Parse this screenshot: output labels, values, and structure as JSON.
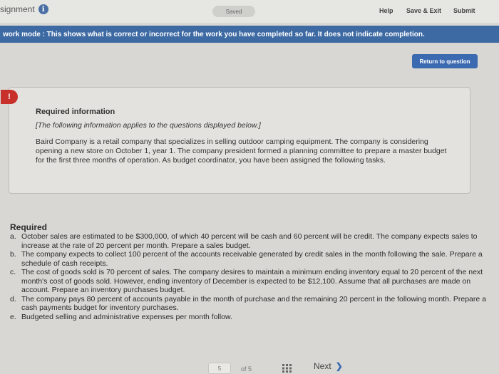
{
  "topbar": {
    "assignment_label": "signment",
    "saved_label": "Saved",
    "help_label": "Help",
    "save_exit_label": "Save & Exit",
    "submit_label": "Submit"
  },
  "mode_banner": "work mode : This shows what is correct or incorrect for the work you have completed so far. It does not indicate completion.",
  "return_button": "Return to question",
  "alert_badge": "!",
  "required_information": {
    "title": "Required information",
    "subtitle": "[The following information applies to the questions displayed below.]",
    "body": "Baird Company is a retail company that specializes in selling outdoor camping equipment. The company is considering opening a new store on October 1, year 1. The company president formed a planning committee to prepare a master budget for the first three months of operation. As budget coordinator, you have been assigned the following tasks."
  },
  "required": {
    "title": "Required",
    "items": [
      {
        "letter": "a.",
        "text": "October sales are estimated to be $300,000, of which 40 percent will be cash and 60 percent will be credit. The company expects sales to increase at the rate of 20 percent per month. Prepare a sales budget."
      },
      {
        "letter": "b.",
        "text": "The company expects to collect 100 percent of the accounts receivable generated by credit sales in the month following the sale. Prepare a schedule of cash receipts."
      },
      {
        "letter": "c.",
        "text": "The cost of goods sold is 70 percent of sales. The company desires to maintain a minimum ending inventory equal to 20 percent of the next month's cost of goods sold. However, ending inventory of December is expected to be $12,100. Assume that all purchases are made on account. Prepare an inventory purchases budget."
      },
      {
        "letter": "d.",
        "text": "The company pays 80 percent of accounts payable in the month of purchase and the remaining 20 percent in the following month. Prepare a cash payments budget for inventory purchases."
      },
      {
        "letter": "e.",
        "text": "Budgeted selling and administrative expenses per month follow."
      }
    ]
  },
  "bottom_nav": {
    "page_control": "5",
    "page_of": "of 5",
    "next_label": "Next"
  }
}
